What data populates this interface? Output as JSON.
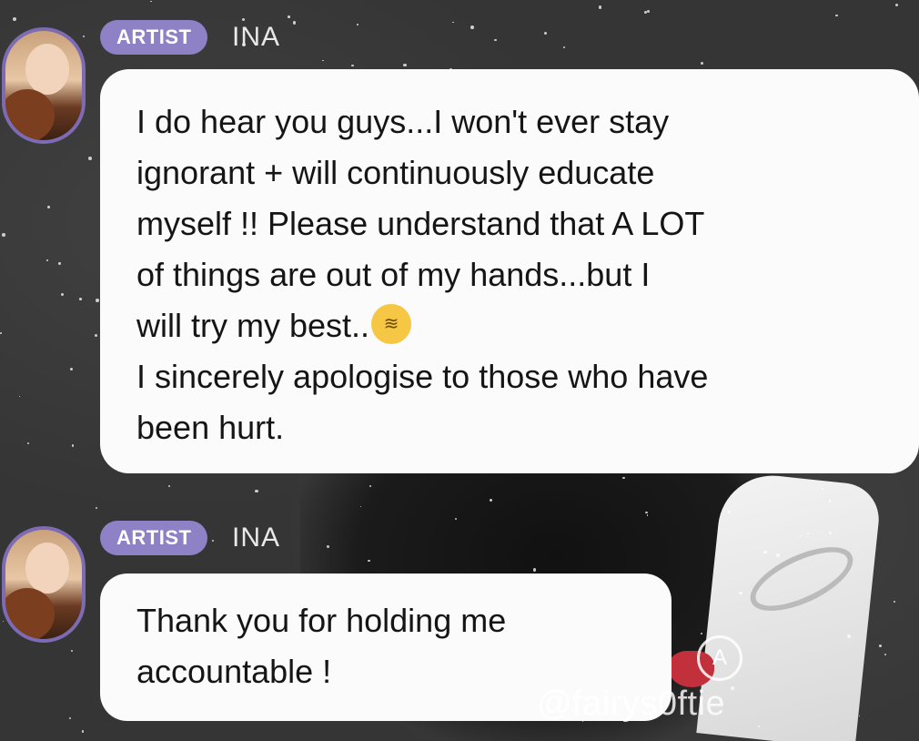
{
  "messages": [
    {
      "badge": "ARTIST",
      "author": "INA",
      "lines": [
        "I do hear you guys...I won't ever stay",
        "ignorant + will continuously educate",
        "myself !! Please understand that A LOT",
        "of things are out of my hands...but I",
        "will try my best..",
        "I sincerely apologise to those who have",
        "been hurt."
      ],
      "emoji": "zipper-mouth-face"
    },
    {
      "badge": "ARTIST",
      "author": "INA",
      "lines": [
        "Thank you for holding me",
        "accountable !"
      ]
    }
  ],
  "watermark": {
    "icon_letter": "A",
    "handle": "@fairys0ftie"
  },
  "colors": {
    "badge": "#8e81c6",
    "avatar_ring": "#7d6bb3",
    "bubble": "#fbfbfb"
  }
}
